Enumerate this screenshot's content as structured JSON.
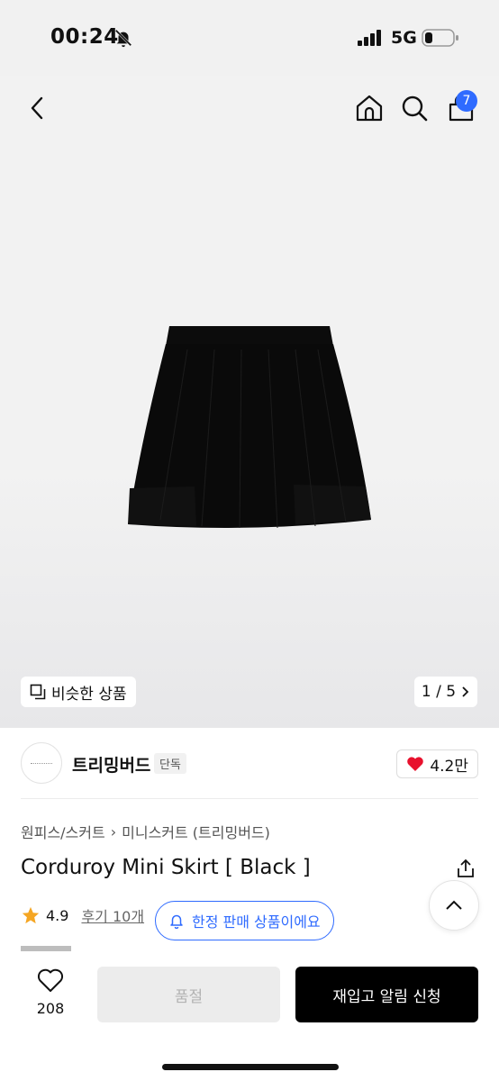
{
  "status": {
    "time": "00:24",
    "network": "5G"
  },
  "header": {
    "cart_count": "7"
  },
  "gallery": {
    "similar_label": "비슷한 상품",
    "pager": "1 / 5"
  },
  "brand": {
    "name": "트리밍버드",
    "tag": "단독",
    "likes": "4.2만"
  },
  "breadcrumb": {
    "parent": "원피스/스커트",
    "child": "미니스커트 (트리밍버드)"
  },
  "product": {
    "title": "Corduroy Mini Skirt [ Black ]",
    "rating": "4.9",
    "reviews": "후기 10개"
  },
  "notice": {
    "limited_label": "한정 판매 상품이에요"
  },
  "bottom": {
    "wish_count": "208",
    "soldout_label": "품절",
    "restock_label": "재입고 알림 신청"
  },
  "colors": {
    "accent": "#2f6bff",
    "heart": "#e8112d",
    "star": "#f5a623"
  }
}
